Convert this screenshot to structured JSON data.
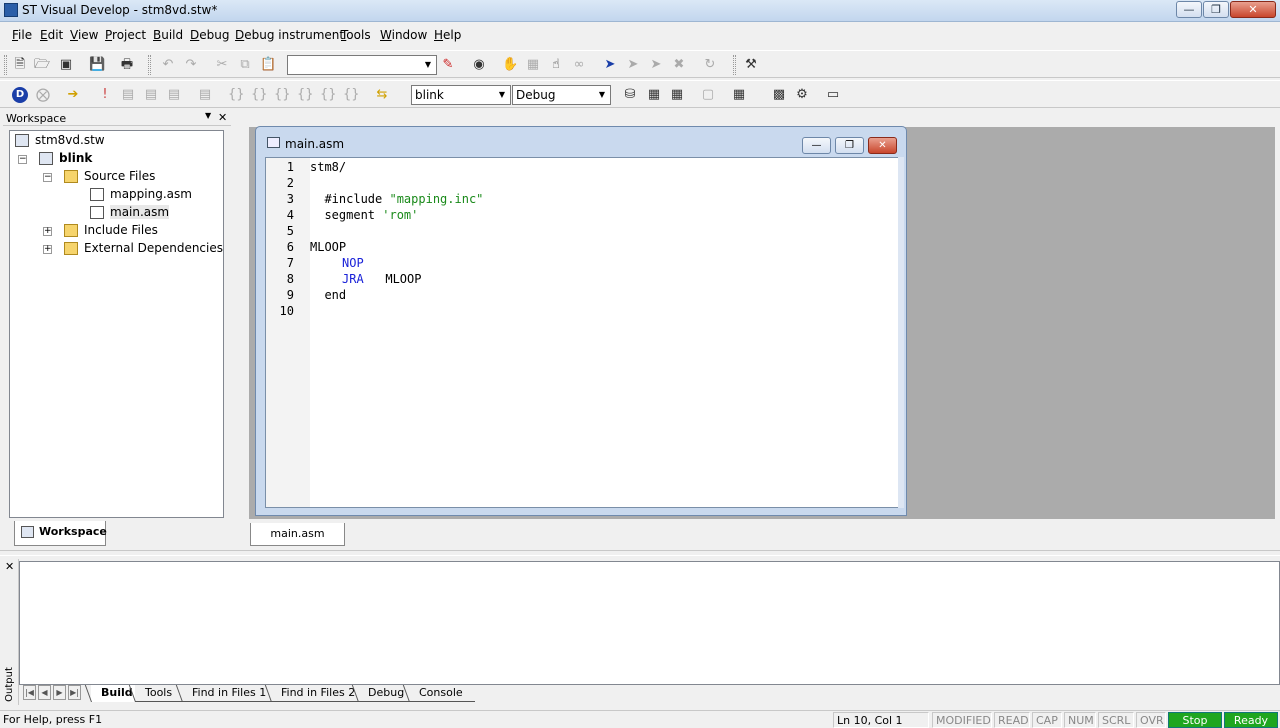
{
  "window": {
    "title": "ST Visual Develop - stm8vd.stw*",
    "min_icon": "minimize-icon",
    "max_icon": "maximize-icon",
    "close_icon": "close-icon"
  },
  "menu": {
    "file": "File",
    "edit": "Edit",
    "view": "View",
    "project": "Project",
    "build": "Build",
    "debug": "Debug",
    "debug_instrument": "Debug instrument",
    "tools": "Tools",
    "window": "Window",
    "help": "Help"
  },
  "toolbar": {
    "find_combo_value": "",
    "project_combo_value": "blink",
    "config_combo_value": "Debug"
  },
  "workspace": {
    "header": "Workspace",
    "root": "stm8vd.stw",
    "project": "blink",
    "source_files": "Source Files",
    "file1": "mapping.asm",
    "file2": "main.asm",
    "include_files": "Include Files",
    "external_deps": "External Dependencies",
    "tab": "Workspace"
  },
  "editor": {
    "title": "main.asm",
    "tab": "main.asm",
    "line_numbers": [
      "1",
      "2",
      "3",
      "4",
      "5",
      "6",
      "7",
      "8",
      "9",
      "10"
    ],
    "lines": {
      "l1": "stm8/",
      "l3a": "  #include ",
      "l3b": "\"mapping.inc\"",
      "l4a": "  segment ",
      "l4b": "'rom'",
      "l6": "MLOOP",
      "l7": "NOP",
      "l8a": "JRA",
      "l8b": "   MLOOP",
      "l9": "  end"
    }
  },
  "output": {
    "label": "Output",
    "tabs": [
      "Build",
      "Tools",
      "Find in Files 1",
      "Find in Files 2",
      "Debug",
      "Console"
    ],
    "active_tab": "Build"
  },
  "status": {
    "help": "For Help, press F1",
    "position": "Ln 10, Col 1",
    "modified": "MODIFIED",
    "read": "READ",
    "cap": "CAP",
    "num": "NUM",
    "scrl": "SCRL",
    "ovr": "OVR",
    "stop": "Stop",
    "ready": "Ready"
  },
  "colors": {
    "keyword": "#1a22d8",
    "string": "#1a8a1a",
    "status_green": "#1fa61f"
  }
}
